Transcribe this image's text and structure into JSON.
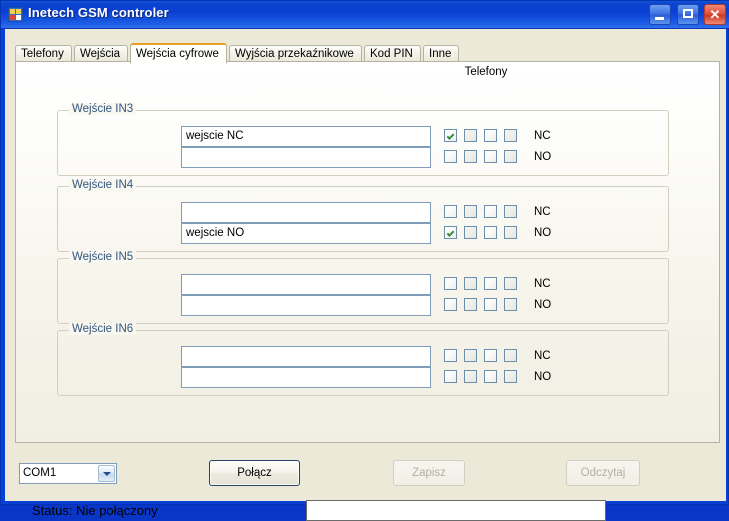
{
  "window": {
    "title": "Inetech GSM controler",
    "icon": "app-icon",
    "buttons": {
      "minimize": "minimize-button",
      "maximize": "maximize-button",
      "close": "close-button",
      "close_glyph": "✕"
    }
  },
  "tabs": [
    {
      "label": "Telefony",
      "selected": false
    },
    {
      "label": "Wejścia",
      "selected": false
    },
    {
      "label": "Wejścia cyfrowe",
      "selected": true
    },
    {
      "label": "Wyjścia przekaźnikowe",
      "selected": false
    },
    {
      "label": "Kod PIN",
      "selected": false
    },
    {
      "label": "Inne",
      "selected": false
    }
  ],
  "panel": {
    "column_header": "Telefony",
    "groups": [
      {
        "label": "Wejście IN3",
        "rows": [
          {
            "mode": "NC",
            "text": "wejscie NC",
            "checks": [
              true,
              false,
              false,
              false
            ]
          },
          {
            "mode": "NO",
            "text": "",
            "checks": [
              false,
              false,
              false,
              false
            ]
          }
        ]
      },
      {
        "label": "Wejście IN4",
        "rows": [
          {
            "mode": "NC",
            "text": "",
            "checks": [
              false,
              false,
              false,
              false
            ]
          },
          {
            "mode": "NO",
            "text": "wejscie NO",
            "checks": [
              true,
              false,
              false,
              false
            ]
          }
        ]
      },
      {
        "label": "Wejście IN5",
        "rows": [
          {
            "mode": "NC",
            "text": "",
            "checks": [
              false,
              false,
              false,
              false
            ]
          },
          {
            "mode": "NO",
            "text": "",
            "checks": [
              false,
              false,
              false,
              false
            ]
          }
        ]
      },
      {
        "label": "Wejście IN6",
        "rows": [
          {
            "mode": "NC",
            "text": "",
            "checks": [
              false,
              false,
              false,
              false
            ]
          },
          {
            "mode": "NO",
            "text": "",
            "checks": [
              false,
              false,
              false,
              false
            ]
          }
        ]
      }
    ]
  },
  "bottom": {
    "port_select": {
      "value": "COM1",
      "options": [
        "COM1"
      ]
    },
    "connect_button": "Połącz",
    "save_button": "Zapisz",
    "read_button": "Odczytaj",
    "status_text": "Status: Nie połączony",
    "status_field_value": ""
  },
  "colors": {
    "titlebar": "#0a3fd6",
    "client": "#ece9d8",
    "selected_tab_accent": "#e59f26",
    "group_label": "#33557f",
    "check_mark": "#3d8a3d"
  }
}
